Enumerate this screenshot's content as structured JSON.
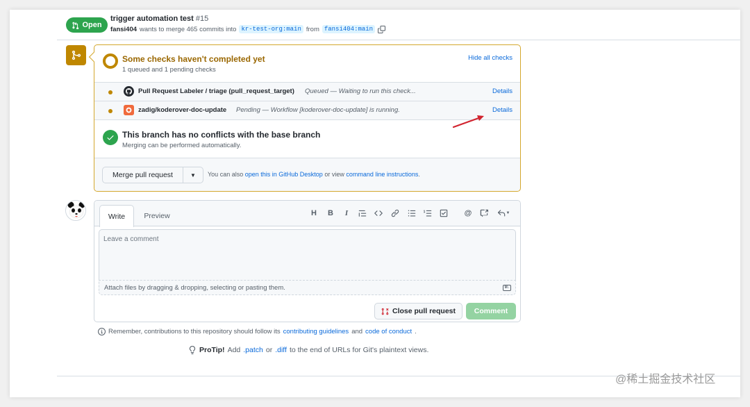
{
  "pr": {
    "status": "Open",
    "title": "trigger automation test",
    "number": "#15",
    "author": "fansi404",
    "merge_text": "wants to merge 465 commits into",
    "base_branch": "kr-test-org:main",
    "from_text": "from",
    "head_branch": "fansi404:main"
  },
  "checks": {
    "title": "Some checks haven't completed yet",
    "subtitle": "1 queued and 1 pending checks",
    "hide_label": "Hide all checks",
    "rows": [
      {
        "name": "Pull Request Labeler / triage (pull_request_target)",
        "description": "Queued — Waiting to run this check...",
        "details": "Details"
      },
      {
        "name": "zadig/koderover-doc-update",
        "description": "Pending — Workflow [koderover-doc-update] is running.",
        "details": "Details"
      }
    ]
  },
  "conflicts": {
    "title": "This branch has no conflicts with the base branch",
    "subtitle": "Merging can be performed automatically."
  },
  "merge": {
    "button_label": "Merge pull request",
    "hint_prefix": "You can also",
    "hint_link1": "open this in GitHub Desktop",
    "hint_mid": "or view",
    "hint_link2": "command line instructions",
    "hint_suffix": "."
  },
  "comment": {
    "tab_write": "Write",
    "tab_preview": "Preview",
    "placeholder": "Leave a comment",
    "attach_text": "Attach files by dragging & dropping, selecting or pasting them.",
    "close_label": "Close pull request",
    "comment_label": "Comment"
  },
  "remember": {
    "prefix": "Remember, contributions to this repository should follow its",
    "link1": "contributing guidelines",
    "mid": "and",
    "link2": "code of conduct",
    "suffix": "."
  },
  "protip": {
    "label": "ProTip!",
    "text1": "Add",
    "link1": ".patch",
    "text2": "or",
    "link2": ".diff",
    "text3": "to the end of URLs for Git's plaintext views."
  },
  "watermark": "@稀土掘金技术社区",
  "colors": {
    "accent": "#0969da",
    "success": "#2da44e",
    "attention": "#bf8700",
    "arrow": "#d1242f"
  }
}
